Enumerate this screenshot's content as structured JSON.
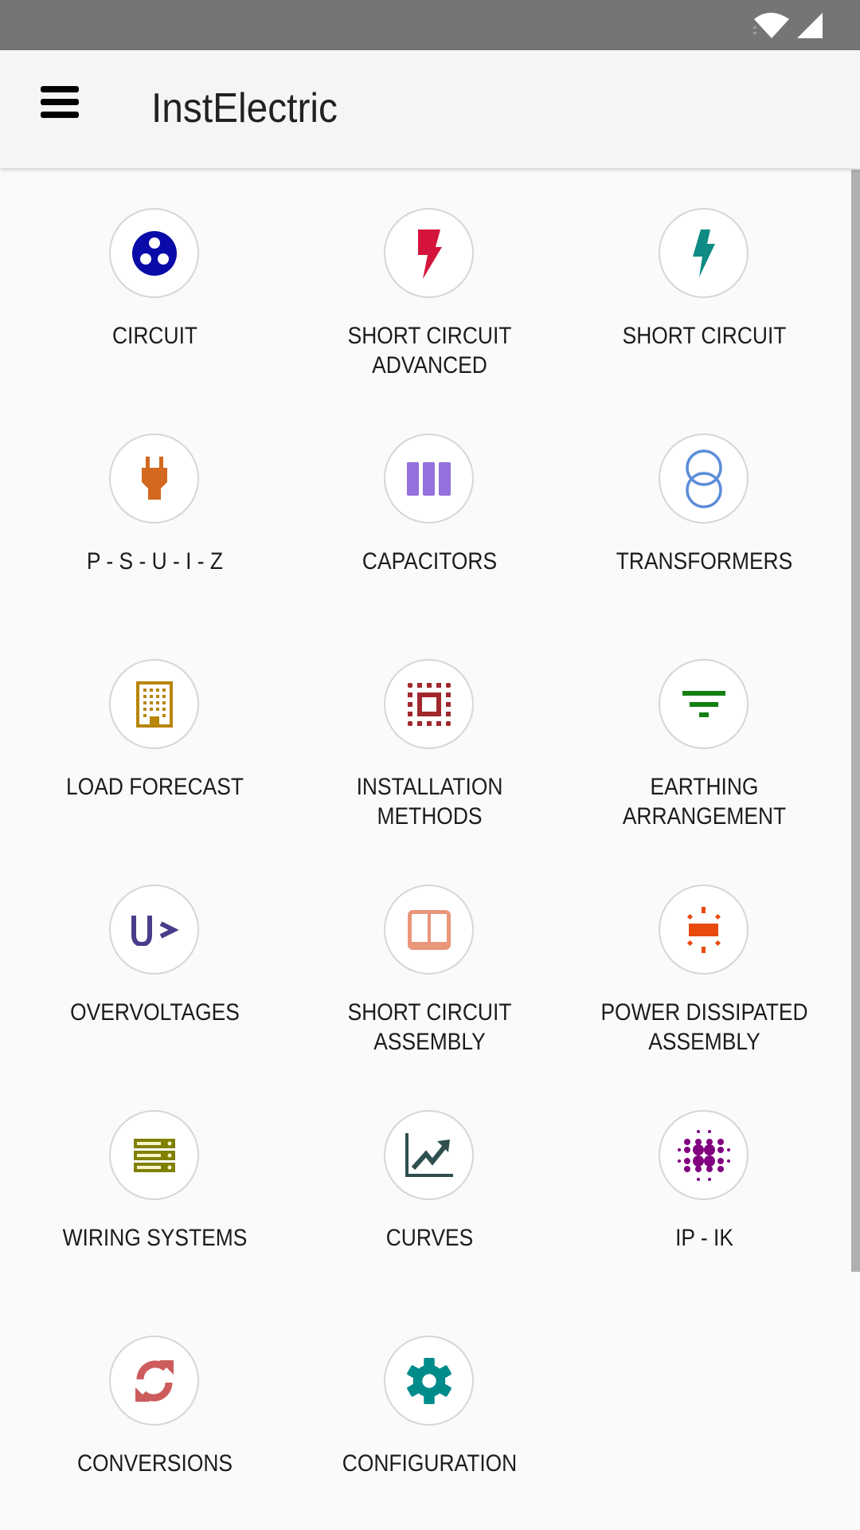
{
  "status_bar": {
    "icons": [
      "wifi-icon",
      "cell-signal-icon"
    ]
  },
  "app_bar": {
    "menu_icon": "hamburger-menu-icon",
    "title": "InstElectric"
  },
  "colors": {
    "status_bar": "#757575",
    "app_bar": "#f5f5f5",
    "background": "#fafafa",
    "circuit": "#0a0aa8",
    "short_circuit_advanced": "#d4143c",
    "short_circuit": "#0f8a84",
    "psuiz": "#d2691e",
    "capacitors": "#9370db",
    "transformers": "#5b8dd9",
    "load_forecast": "#b8860b",
    "installation_methods": "#a0282d",
    "earthing_arrangement": "#128012",
    "overvoltages": "#483d8b",
    "short_circuit_assembly": "#e9967a",
    "power_dissipated_assembly": "#e84a0c",
    "wiring_systems": "#808000",
    "curves": "#2f4f4f",
    "ip_ik": "#800080",
    "conversions": "#cd5c5c",
    "configuration": "#008b8b"
  },
  "menu": [
    {
      "id": "circuit",
      "icon": "circuit-icon",
      "line1": "CIRCUIT",
      "line2": ""
    },
    {
      "id": "short-circuit-advanced",
      "icon": "lightning-bolt-icon",
      "line1": "SHORT CIRCUIT",
      "line2": "ADVANCED"
    },
    {
      "id": "short-circuit",
      "icon": "lightning-bolt-icon",
      "line1": "SHORT CIRCUIT",
      "line2": ""
    },
    {
      "id": "psuiz",
      "icon": "power-plug-icon",
      "line1": "P - S - U - I - Z",
      "line2": ""
    },
    {
      "id": "capacitors",
      "icon": "capacitor-bars-icon",
      "line1": "CAPACITORS",
      "line2": ""
    },
    {
      "id": "transformers",
      "icon": "transformer-rings-icon",
      "line1": "TRANSFORMERS",
      "line2": ""
    },
    {
      "id": "load-forecast",
      "icon": "building-icon",
      "line1": "LOAD FORECAST",
      "line2": ""
    },
    {
      "id": "installation-methods",
      "icon": "select-all-icon",
      "line1": "INSTALLATION",
      "line2": "METHODS"
    },
    {
      "id": "earthing-arrangement",
      "icon": "earth-ground-icon",
      "line1": "EARTHING",
      "line2": "ARRANGEMENT"
    },
    {
      "id": "overvoltages",
      "icon": "overvoltage-icon",
      "line1": "OVERVOLTAGES",
      "line2": ""
    },
    {
      "id": "short-circuit-assembly",
      "icon": "panel-assembly-icon",
      "line1": "SHORT CIRCUIT",
      "line2": "ASSEMBLY"
    },
    {
      "id": "power-dissipated-assembly",
      "icon": "heat-dissipation-icon",
      "line1": "POWER DISSIPATED",
      "line2": "ASSEMBLY"
    },
    {
      "id": "wiring-systems",
      "icon": "server-rack-icon",
      "line1": "WIRING SYSTEMS",
      "line2": ""
    },
    {
      "id": "curves",
      "icon": "trending-up-chart-icon",
      "line1": "CURVES",
      "line2": ""
    },
    {
      "id": "ip-ik",
      "icon": "dot-grid-icon",
      "line1": "IP - IK",
      "line2": ""
    },
    {
      "id": "conversions",
      "icon": "sync-arrows-icon",
      "line1": "CONVERSIONS",
      "line2": ""
    },
    {
      "id": "configuration",
      "icon": "gear-icon",
      "line1": "CONFIGURATION",
      "line2": ""
    }
  ]
}
